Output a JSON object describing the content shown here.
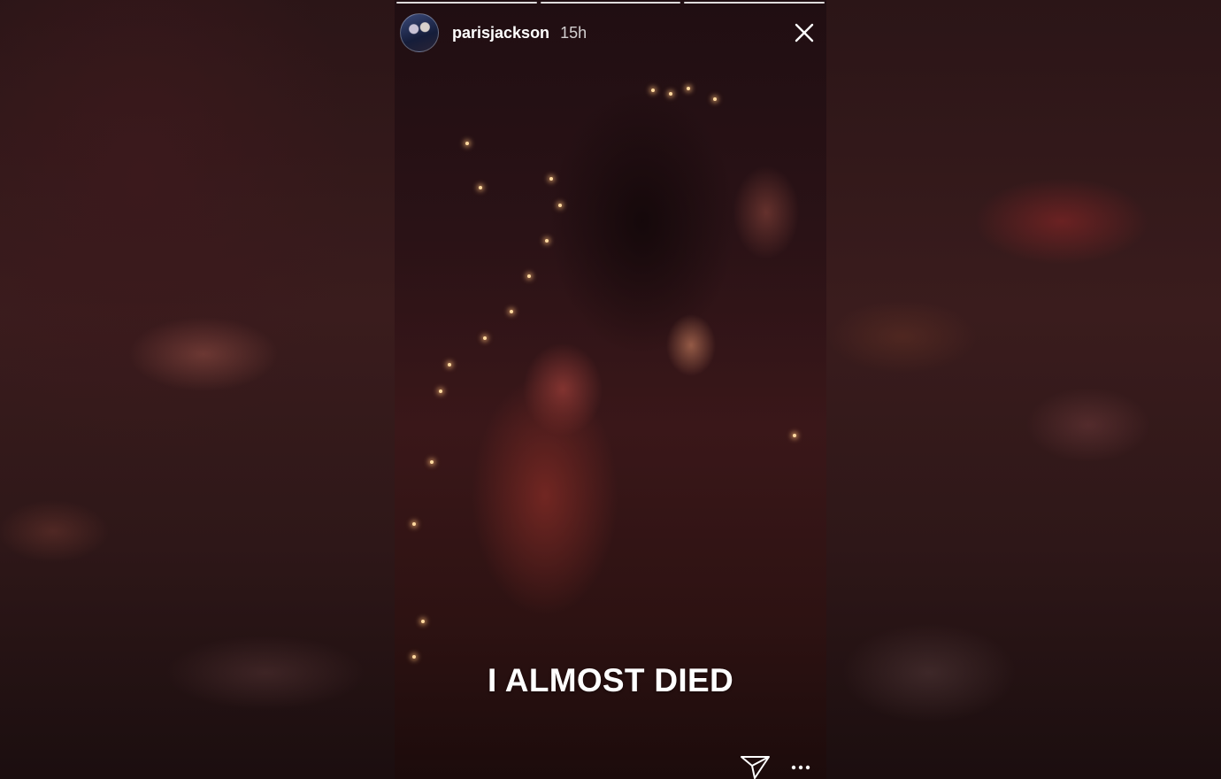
{
  "story": {
    "progress_segments": 3,
    "username": "parisjackson",
    "time_ago": "15h",
    "caption": "I ALMOST DIED"
  },
  "icons": {
    "close": "close-icon",
    "send": "send-direct-icon",
    "more": "more-options-icon",
    "avatar": "profile-avatar"
  },
  "colors": {
    "text": "#ffffff",
    "background": "#2a1216"
  }
}
